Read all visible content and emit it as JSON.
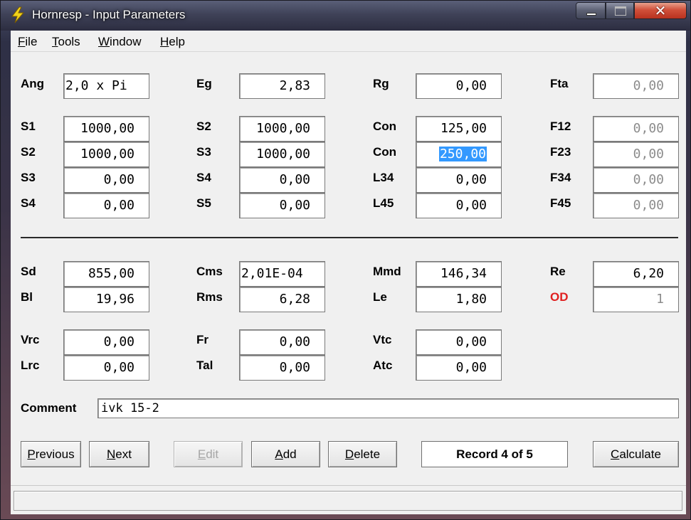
{
  "window": {
    "title": "Hornresp - Input Parameters",
    "close_glyph": "✕"
  },
  "menu": [
    {
      "key": "F",
      "rest": "ile"
    },
    {
      "key": "T",
      "rest": "ools"
    },
    {
      "key": "W",
      "rest": "indow"
    },
    {
      "key": "H",
      "rest": "elp"
    }
  ],
  "row0": {
    "ang_label": "Ang",
    "ang_value": "2,0 x Pi",
    "eg_label": "Eg",
    "eg_value": "2,83",
    "rg_label": "Rg",
    "rg_value": "0,00",
    "fta_label": "Fta",
    "fta_value": "0,00"
  },
  "horn": {
    "col1": [
      {
        "label": "S1",
        "value": "1000,00"
      },
      {
        "label": "S2",
        "value": "1000,00"
      },
      {
        "label": "S3",
        "value": "0,00"
      },
      {
        "label": "S4",
        "value": "0,00"
      }
    ],
    "col2": [
      {
        "label": "S2",
        "value": "1000,00"
      },
      {
        "label": "S3",
        "value": "1000,00"
      },
      {
        "label": "S4",
        "value": "0,00"
      },
      {
        "label": "S5",
        "value": "0,00"
      }
    ],
    "col3": [
      {
        "label": "Con",
        "value": "125,00"
      },
      {
        "label": "Con",
        "value": "250,00"
      },
      {
        "label": "L34",
        "value": "0,00"
      },
      {
        "label": "L45",
        "value": "0,00"
      }
    ],
    "col4": [
      {
        "label": "F12",
        "value": "0,00"
      },
      {
        "label": "F23",
        "value": "0,00"
      },
      {
        "label": "F34",
        "value": "0,00"
      },
      {
        "label": "F45",
        "value": "0,00"
      }
    ]
  },
  "driver": {
    "sd_label": "Sd",
    "sd_value": "855,00",
    "bl_label": "Bl",
    "bl_value": "19,96",
    "cms_label": "Cms",
    "cms_value": "2,01E-04",
    "rms_label": "Rms",
    "rms_value": "6,28",
    "mmd_label": "Mmd",
    "mmd_value": "146,34",
    "le_label": "Le",
    "le_value": "1,80",
    "re_label": "Re",
    "re_value": "6,20",
    "od_label": "OD",
    "od_value": "1"
  },
  "chambers": {
    "vrc_label": "Vrc",
    "vrc_value": "0,00",
    "lrc_label": "Lrc",
    "lrc_value": "0,00",
    "fr_label": "Fr",
    "fr_value": "0,00",
    "tal_label": "Tal",
    "tal_value": "0,00",
    "vtc_label": "Vtc",
    "vtc_value": "0,00",
    "atc_label": "Atc",
    "atc_value": "0,00"
  },
  "comment": {
    "label": "Comment",
    "value": "ivk 15-2"
  },
  "buttons": {
    "previous": {
      "key": "P",
      "rest": "revious"
    },
    "next": {
      "key": "N",
      "rest": "ext"
    },
    "edit": {
      "key": "E",
      "rest": "dit"
    },
    "add": {
      "key": "A",
      "rest": "dd"
    },
    "delete": {
      "key": "D",
      "rest": "elete"
    },
    "calculate": {
      "key": "C",
      "rest": "alculate"
    }
  },
  "record": "Record 4 of 5",
  "colors": {
    "od_label": "#e02020",
    "selection": "#3399ff",
    "disabled_text": "#8c8c8c"
  },
  "icons": {
    "app": "lightning-bolt-icon"
  }
}
